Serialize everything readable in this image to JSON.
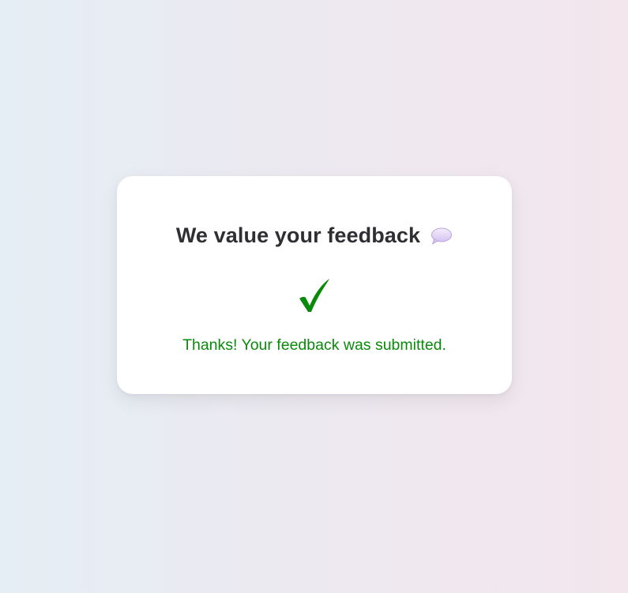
{
  "card": {
    "title": "We value your feedback",
    "title_icon": "speech-bubble-icon",
    "status_icon": "checkmark-icon",
    "message": "Thanks! Your feedback was submitted."
  },
  "colors": {
    "title": "#2e2e33",
    "success": "#0a8a0a",
    "bubble": "#d9c8f2",
    "background_left": "#e5eef5",
    "background_right": "#f3e6ed"
  }
}
